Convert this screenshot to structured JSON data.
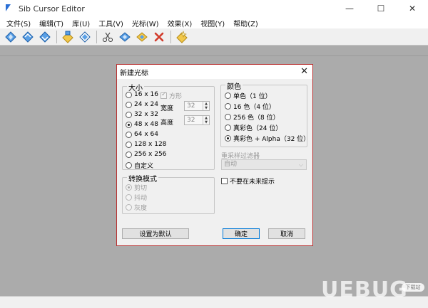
{
  "window": {
    "title": "Sib Cursor Editor",
    "controls": [
      "—",
      "☐",
      "✕"
    ]
  },
  "menu": [
    "文件(S)",
    "编辑(T)",
    "库(U)",
    "工具(V)",
    "光标(W)",
    "效果(X)",
    "视图(Y)",
    "帮助(Z)"
  ],
  "toolbar": {
    "icons": [
      "new-icon",
      "open-icon",
      "save-icon",
      "export-icon",
      "import-icon",
      "cut-icon",
      "copy-icon",
      "paste-icon",
      "delete-icon",
      "effect-icon"
    ]
  },
  "dialog": {
    "title": "新建光标",
    "size": {
      "label": "大小",
      "options": [
        "16 x 16",
        "24 x 24",
        "32 x 32",
        "48 x 48",
        "64 x 64",
        "128 x 128",
        "256 x 256",
        "自定义"
      ],
      "selected": "48 x 48",
      "square_label": "方形",
      "width_label": "宽度",
      "width_value": "32",
      "height_label": "高度",
      "height_value": "32"
    },
    "color": {
      "label": "颜色",
      "options": [
        "单色（1 位）",
        "16 色（4 位）",
        "256 色（8 位）",
        "真彩色（24 位）",
        "真彩色 + Alpha（32 位）"
      ],
      "selected": "真彩色 + Alpha（32 位）"
    },
    "resample": {
      "label": "重采样过滤器",
      "value": "自动"
    },
    "convert": {
      "label": "转换模式",
      "options": [
        "剪切",
        "抖动",
        "灰度"
      ],
      "selected": "剪切"
    },
    "dont_show_label": "不要在未来提示",
    "default_button": "设置为默认",
    "ok_button": "确定",
    "cancel_button": "取消"
  },
  "watermark": {
    "text": "UEBUG",
    "tag": "下载站"
  }
}
